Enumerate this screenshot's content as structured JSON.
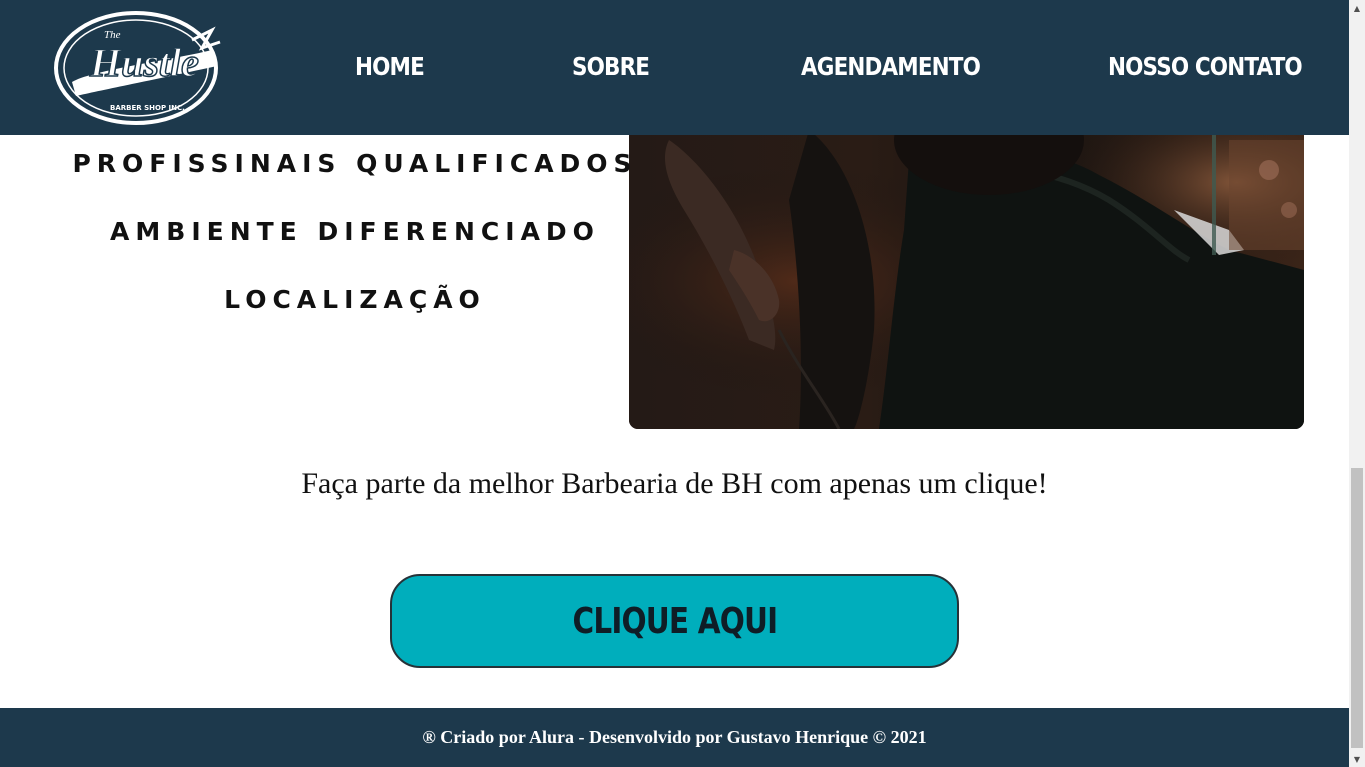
{
  "header": {
    "logo": {
      "brand": "Hustle",
      "tagline": "BARBER SHOP INC.",
      "small": "The"
    },
    "nav": [
      {
        "label": "HOME"
      },
      {
        "label": "SOBRE"
      },
      {
        "label": "AGENDAMENTO"
      },
      {
        "label": "NOSSO CONTATO"
      }
    ]
  },
  "features": [
    "PROFISSINAIS QUALIFICADOS",
    "AMBIENTE DIFERENCIADO",
    "LOCALIZAÇÃO"
  ],
  "tagline": "Faça parte da melhor Barbearia de BH com apenas um clique!",
  "cta": {
    "label": "CLIQUE AQUI"
  },
  "footer": {
    "text": "® Criado por Alura - Desenvolvido por Gustavo Henrique © 2021"
  },
  "colors": {
    "header_bg": "#1d394c",
    "cta_bg": "#00aebc",
    "footer_bg": "#1d394c"
  }
}
